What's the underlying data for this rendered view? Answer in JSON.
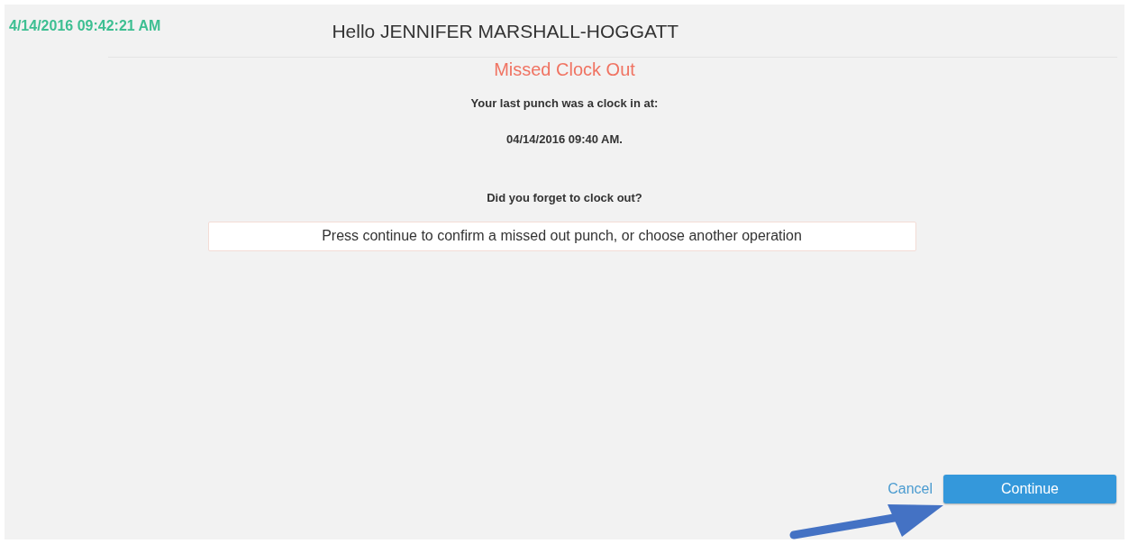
{
  "header": {
    "timestamp": "4/14/2016 09:42:21 AM",
    "greeting": "Hello JENNIFER MARSHALL-HOGGATT"
  },
  "dialog": {
    "title": "Missed Clock Out",
    "lines": [
      "Your last punch was a clock in at:",
      "04/14/2016 09:40 AM.",
      "Did you forget to clock out?"
    ],
    "message": "Press continue to confirm a missed out punch, or choose another operation"
  },
  "buttons": {
    "cancel": "Cancel",
    "continue": "Continue"
  }
}
